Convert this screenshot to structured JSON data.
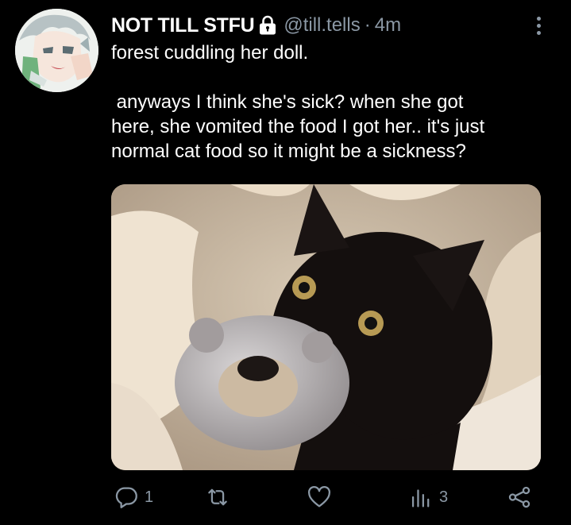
{
  "tweet": {
    "display_name": "NOT TILL STFU",
    "handle": "@till.tells",
    "separator": "·",
    "time": "4m",
    "lines_1": [
      "forest cuddling her doll."
    ],
    "lines_2": [
      " anyways I think she's sick? when she got",
      "here, she vomited the food I got her.. it's just",
      "normal cat food so it might be a sickness?"
    ]
  },
  "actions": {
    "reply_count": "1",
    "views_count": "3"
  },
  "colors": {
    "background": "#000000",
    "text": "#ffffff",
    "secondary": "#8b98a5"
  },
  "icons": [
    "lock-icon",
    "more-icon",
    "reply-icon",
    "retweet-icon",
    "like-icon",
    "views-icon",
    "share-icon"
  ]
}
